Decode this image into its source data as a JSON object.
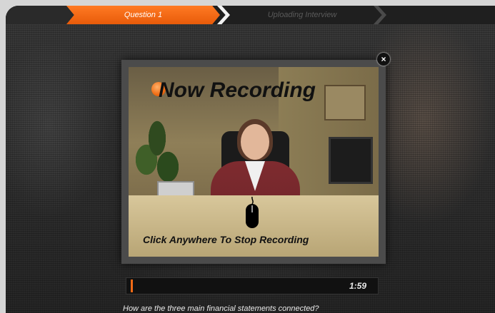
{
  "steps": {
    "active_label": "Question 1",
    "inactive_label": "Uploading Interview"
  },
  "modal": {
    "title": "Now Recording",
    "instruction": "Click Anywhere To Stop Recording",
    "close_label": "×"
  },
  "timer": {
    "time": "1:59"
  },
  "question": {
    "text": "How are the three main financial statements connected?"
  },
  "colors": {
    "accent": "#f26a16",
    "step_active": "#ff7a24"
  },
  "icons": {
    "record": "record-dot-icon",
    "mouse": "mouse-icon",
    "close": "close-icon"
  }
}
